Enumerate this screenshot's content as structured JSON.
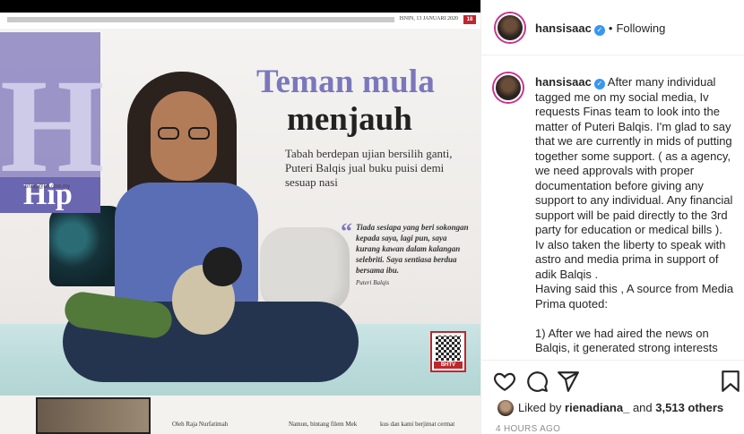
{
  "post_image": {
    "date": "ISNIN, 13 JANUARI 2020",
    "page_tag": "18",
    "section_letter": "H",
    "section_word": "Hip",
    "section_url": "bhhip@bh.com.my",
    "headline_line1": "Teman mula",
    "headline_line2": "menjauh",
    "standfirst": "Tabah berdepan ujian bersilih ganti, Puteri Balqis jual buku puisi demi sesuap nasi",
    "quote": "Tiada sesiapa yang beri sokongan kepada saya, lagi pun, saya kurang kawan dalam kalangan selebriti. Saya sentiasa berdua bersama ibu.",
    "quote_attribution": "Puteri Balqis",
    "qr_tag": "BHTV",
    "byline": "Oleh Raja Nurfatimah",
    "col2": "Namun, bintang filem Mek",
    "col3": "kus dan kami berjimat cermat"
  },
  "header": {
    "username": "hansisaac",
    "verified": "✓",
    "separator": "•",
    "follow_status": "Following"
  },
  "caption": {
    "username": "hansisaac",
    "text": "After many individual tagged me on my social media, Iv requests Finas team to look into the matter of Puteri Balqis. I'm glad to say that we are currently in mids of putting together some support. ( as a agency, we need approvals with proper documentation before giving any support to any individual. Any financial support will be paid directly to the 3rd party for education or medical bills ). Iv also taken the liberty to speak with astro and media prima in support of adik Balqis .\nHaving said this , A source from Media Prima quoted:\n\n1) After we had aired the news on Balqis, it generated strong interests"
  },
  "actions": {
    "like_icon": "heart-icon",
    "comment_icon": "comment-icon",
    "share_icon": "share-icon",
    "save_icon": "bookmark-icon",
    "liked_by_prefix": "Liked by",
    "liked_by_user": "rienadiana_",
    "liked_by_suffix": "and",
    "likes_count": "3,513 others",
    "timestamp": "4 HOURS AGO"
  },
  "colors": {
    "accent_purple": "#7b77bd",
    "brand_red": "#c0272d",
    "verified_blue": "#3897f0",
    "muted_text": "#8e8e8e"
  }
}
